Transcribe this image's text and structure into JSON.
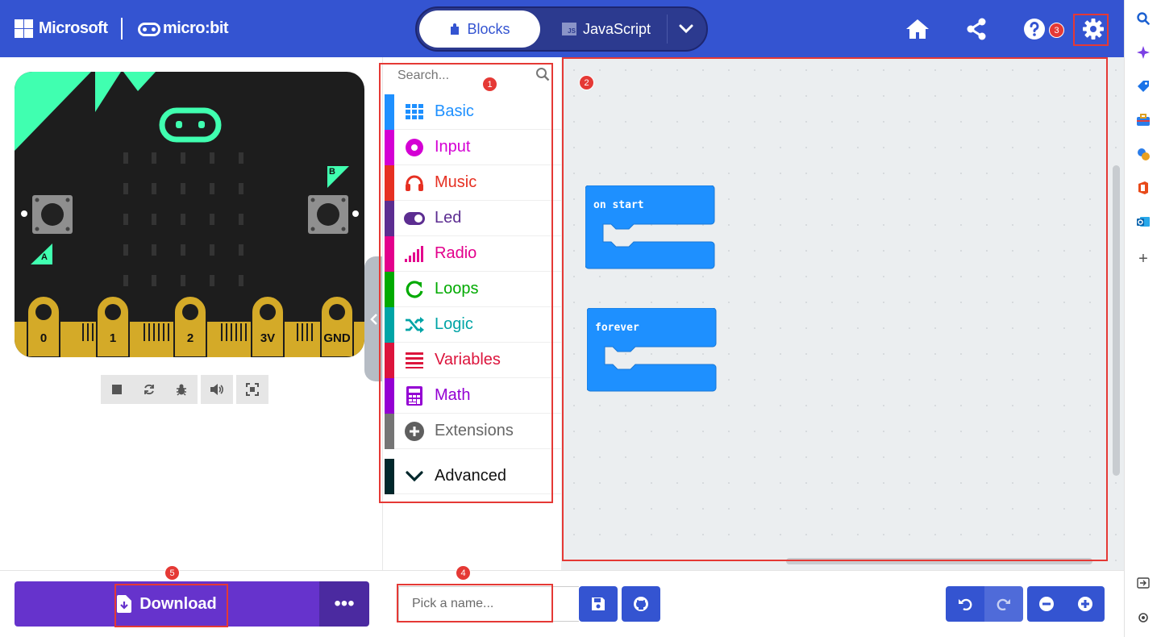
{
  "header": {
    "brand": "Microsoft",
    "product": "micro:bit",
    "modes": {
      "blocks": "Blocks",
      "javascript": "JavaScript",
      "js_badge": "JS"
    }
  },
  "toolbox": {
    "search_placeholder": "Search...",
    "categories": [
      {
        "label": "Basic",
        "color": "#1E90FF",
        "icon": "grid-icon"
      },
      {
        "label": "Input",
        "color": "#D400D4",
        "icon": "target-icon"
      },
      {
        "label": "Music",
        "color": "#E63022",
        "icon": "headphones-icon"
      },
      {
        "label": "Led",
        "color": "#5C2D91",
        "icon": "toggle-icon"
      },
      {
        "label": "Radio",
        "color": "#E3008C",
        "icon": "signal-bars-icon"
      },
      {
        "label": "Loops",
        "color": "#00AA00",
        "icon": "refresh-icon"
      },
      {
        "label": "Logic",
        "color": "#00A4A6",
        "icon": "shuffle-icon"
      },
      {
        "label": "Variables",
        "color": "#DC143C",
        "icon": "list-lines-icon"
      },
      {
        "label": "Math",
        "color": "#9400D3",
        "icon": "calculator-icon"
      },
      {
        "label": "Extensions",
        "color": "#757575",
        "icon": "plus-circle-icon"
      },
      {
        "label": "Advanced",
        "color": "#00272B",
        "icon": "chevron-down-icon"
      }
    ]
  },
  "simulator": {
    "pins": [
      "0",
      "1",
      "2",
      "3V",
      "GND"
    ],
    "button_a": "A",
    "button_b": "B"
  },
  "workspace": {
    "blocks": [
      {
        "label": "on start"
      },
      {
        "label": "forever"
      }
    ]
  },
  "footer": {
    "download_label": "Download",
    "more_label": "•••",
    "name_placeholder": "Pick a name..."
  },
  "annotations": [
    "1",
    "2",
    "3",
    "4",
    "5"
  ],
  "colors": {
    "header": "#3454D1",
    "download": "#6633CC",
    "highlight": "#E53935",
    "block": "#1E90FF",
    "board_accent": "#40FFB0"
  }
}
